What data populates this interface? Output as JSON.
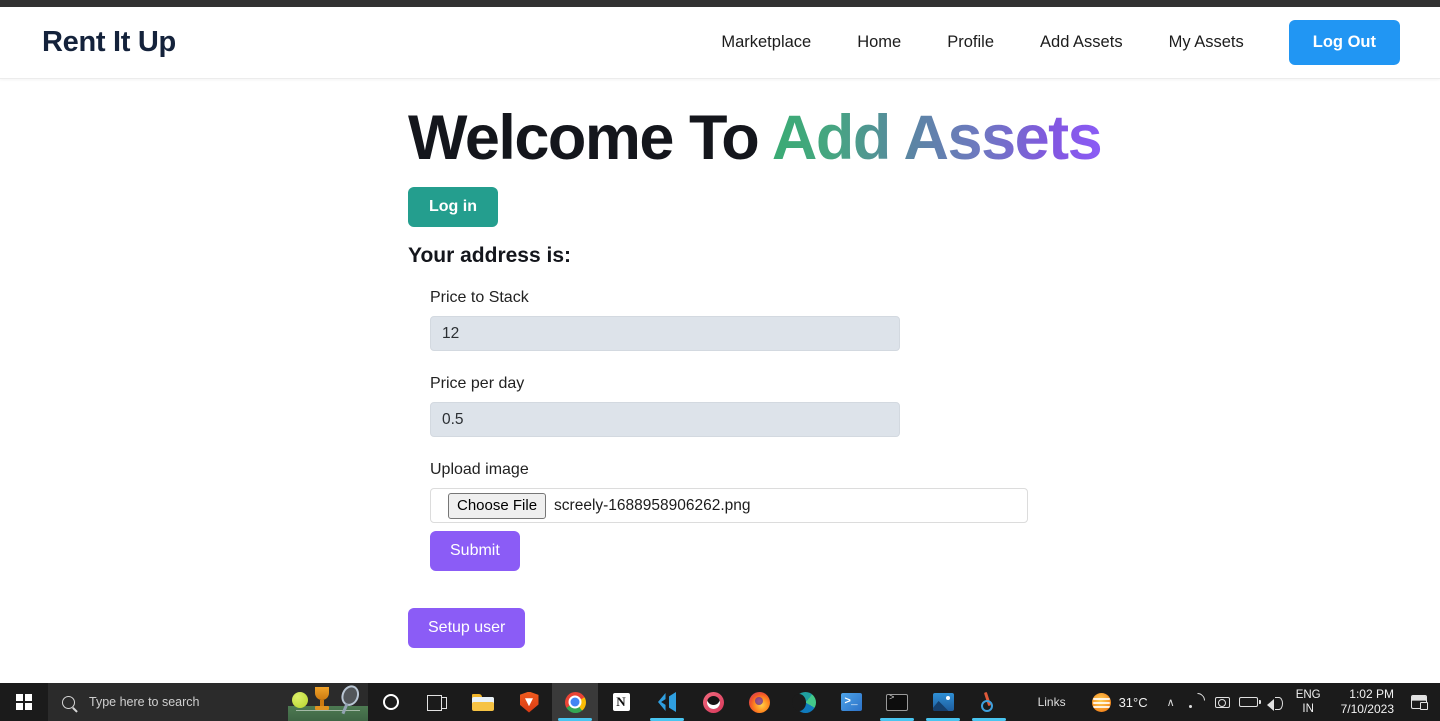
{
  "browser": {
    "top_strip_color": "#323232"
  },
  "navbar": {
    "brand": "Rent It Up",
    "links": [
      {
        "label": "Marketplace",
        "name": "nav-link-marketplace"
      },
      {
        "label": "Home",
        "name": "nav-link-home"
      },
      {
        "label": "Profile",
        "name": "nav-link-profile"
      },
      {
        "label": "Add Assets",
        "name": "nav-link-add-assets"
      },
      {
        "label": "My Assets",
        "name": "nav-link-my-assets"
      }
    ],
    "logout_label": "Log Out",
    "logout_color": "#2196f3"
  },
  "main": {
    "title_static": "Welcome To ",
    "title_highlight": "Add Assets",
    "title_gradient_start": "#3aab74",
    "title_gradient_mid": "#5b85a3",
    "title_gradient_end": "#8b5cf6",
    "login_label": "Log in",
    "login_color": "#249e8e",
    "address_heading": "Your address is:",
    "fields": [
      {
        "label": "Price to Stack",
        "value": "12",
        "name": "price-to-stack"
      },
      {
        "label": "Price per day",
        "value": "0.5",
        "name": "price-per-day"
      }
    ],
    "upload_label": "Upload image",
    "choose_file_label": "Choose File",
    "file_name": "screely-1688958906262.png",
    "submit_label": "Submit",
    "setup_user_label": "Setup user",
    "purple_color": "#8b5cf6"
  },
  "taskbar": {
    "search_placeholder": "Type here to search",
    "apps": [
      {
        "name": "cortana",
        "active": false
      },
      {
        "name": "task-view",
        "active": false
      },
      {
        "name": "file-explorer",
        "active": false
      },
      {
        "name": "brave",
        "active": false
      },
      {
        "name": "chrome",
        "active": true
      },
      {
        "name": "notion",
        "active": false
      },
      {
        "name": "vscode",
        "active": true
      },
      {
        "name": "opera-gx",
        "active": false
      },
      {
        "name": "firefox",
        "active": false
      },
      {
        "name": "edge",
        "active": false
      },
      {
        "name": "powershell",
        "active": false
      },
      {
        "name": "terminal",
        "active": true
      },
      {
        "name": "photos",
        "active": true
      },
      {
        "name": "snipping-tool",
        "active": true
      }
    ],
    "notion_glyph": "N",
    "powershell_glyph": ">_",
    "links_label": "Links",
    "temperature": "31°C",
    "chevron": "∧",
    "lang_top": "ENG",
    "lang_bottom": "IN",
    "time": "1:02 PM",
    "date": "7/10/2023"
  }
}
